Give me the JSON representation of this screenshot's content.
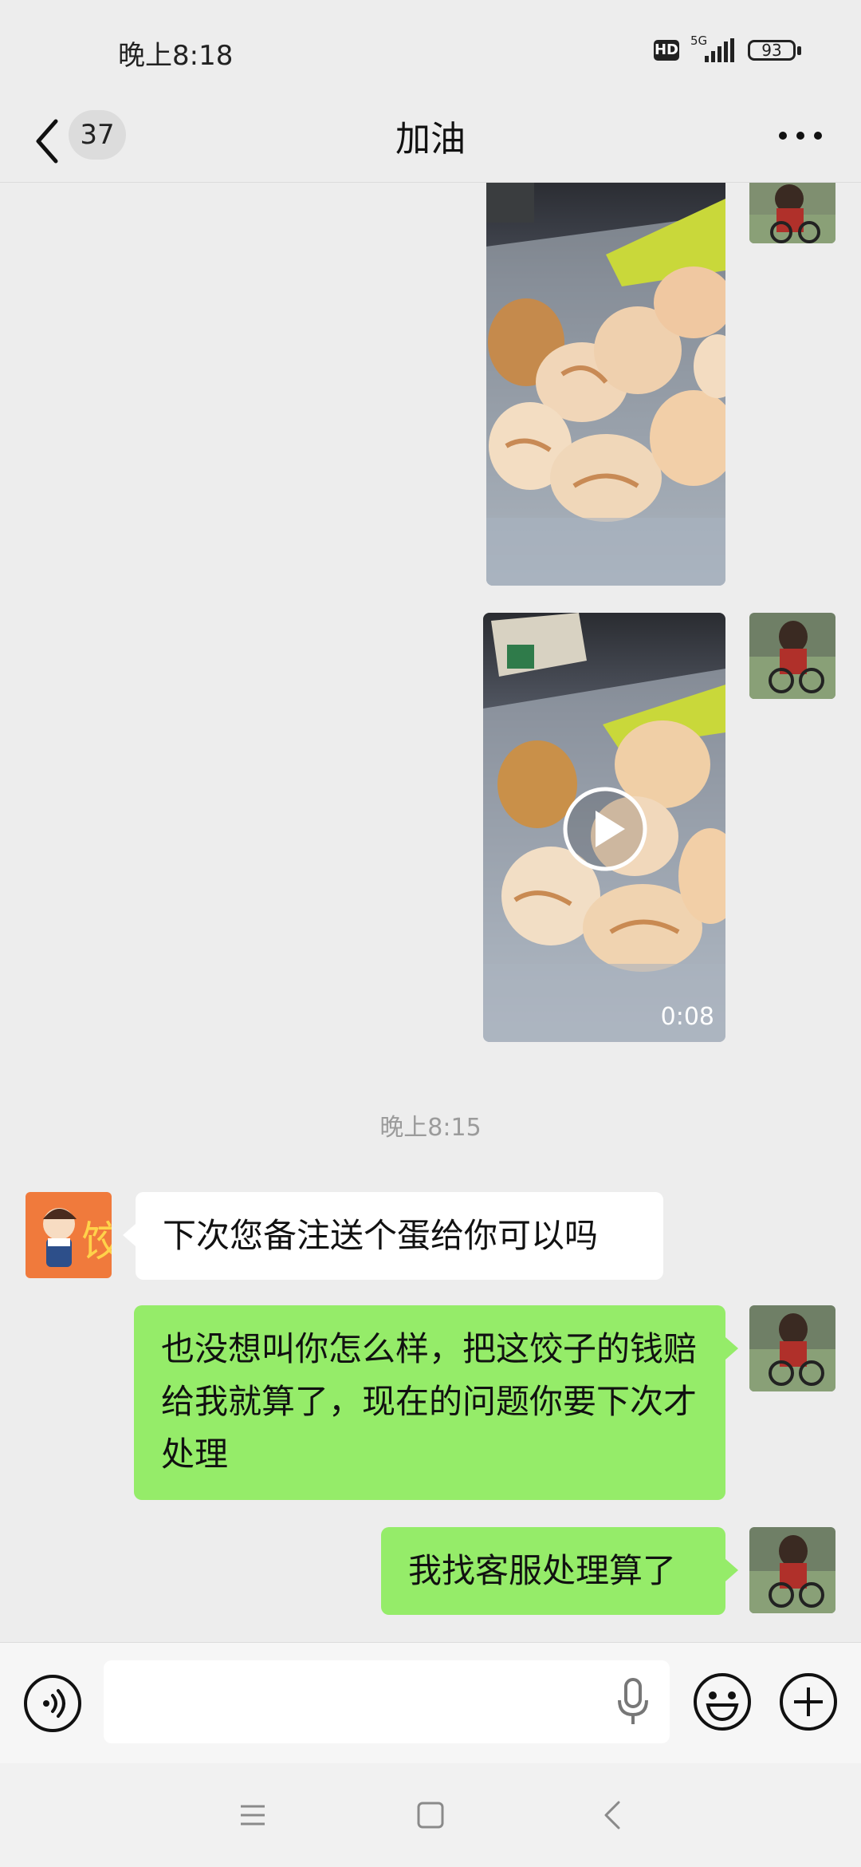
{
  "status_bar": {
    "time": "晚上8:18",
    "hd_label": "HD",
    "network_label": "5G",
    "battery_level": "93"
  },
  "header": {
    "unread_count": "37",
    "title": "加油"
  },
  "messages": [
    {
      "type": "image",
      "side": "right"
    },
    {
      "type": "video",
      "side": "right",
      "duration": "0:08"
    },
    {
      "type": "timestamp",
      "text": "晚上8:15"
    },
    {
      "type": "text",
      "side": "left",
      "text": "下次您备注送个蛋给你可以吗"
    },
    {
      "type": "text",
      "side": "right",
      "text": "也没想叫你怎么样，把这饺子的钱赔给我就算了，现在的问题你要下次才处理"
    },
    {
      "type": "text",
      "side": "right",
      "text": "我找客服处理算了"
    }
  ],
  "input_bar": {
    "icons": [
      "voice-icon",
      "microphone-icon",
      "emoji-icon",
      "plus-icon"
    ]
  },
  "nav_bar": {
    "icons": [
      "menu-icon",
      "home-icon",
      "back-icon"
    ]
  },
  "colors": {
    "background": "#ededed",
    "own_bubble": "#95ec69",
    "other_bubble": "#ffffff",
    "timestamp": "#9b9b9b"
  }
}
